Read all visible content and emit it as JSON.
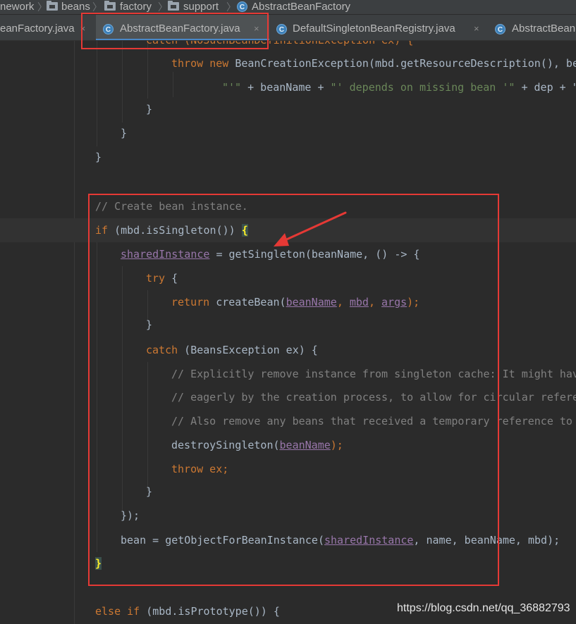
{
  "breadcrumb": {
    "items": [
      "nework",
      "beans",
      "factory",
      "support",
      "AbstractBeanFactory"
    ]
  },
  "tabs": [
    {
      "label": "eanFactory.java",
      "close": "×"
    },
    {
      "label": "AbstractBeanFactory.java",
      "close": "×"
    },
    {
      "label": "DefaultSingletonBeanRegistry.java",
      "close": "×"
    },
    {
      "label": "AbstractBean",
      "close": ""
    }
  ],
  "code": {
    "l0": "catch (NoSuchBeanDefinitionException ex) {",
    "l1_kw1": "throw",
    "l1_kw2": "new",
    "l1_rest": "BeanCreationException(mbd.getResourceDescription(), be",
    "l2_s1": "\"'\"",
    "l2_mid": " + beanName + ",
    "l2_s2": "\"' depends on missing bean '\"",
    "l2_tail": " + dep + \"",
    "l3": "}",
    "l4": "}",
    "l5": "}",
    "l6": "// Create bean instance.",
    "l7_kw": "if",
    "l7_rest": " (mbd.isSingleton()) ",
    "l7_brace": "{",
    "l8_fld": "sharedInstance",
    "l8_rest": " = getSingleton(beanName, () -> {",
    "l9_kw": "try",
    "l9_rest": " {",
    "l10_kw": "return",
    "l10_call": " createBean(",
    "l10_a1": "beanName",
    "l10_a2": "mbd",
    "l10_a3": "args",
    "l10_end": ");",
    "l11": "}",
    "l12_kw": "catch",
    "l12_rest": " (BeansException ex) {",
    "l13": "// Explicitly remove instance from singleton cache: It might hav",
    "l14": "// eagerly by the creation process, to allow for circular refere",
    "l15": "// Also remove any beans that received a temporary reference to",
    "l16_call": "destroySingleton(",
    "l16_arg": "beanName",
    "l16_end": ");",
    "l17_kw": "throw",
    "l17_rest": " ex;",
    "l18": "}",
    "l19": "});",
    "l20_a": "bean = getObjectForBeanInstance(",
    "l20_fld": "sharedInstance",
    "l20_b": ", name, beanName, mbd);",
    "l21": "}",
    "l22_kw1": "else",
    "l22_kw2": "if",
    "l22_rest": " (mbd.isPrototype()) {"
  },
  "watermark": "https://blog.csdn.net/qq_36882793",
  "colors": {
    "keyword": "#cc7832",
    "string": "#6a8759",
    "comment": "#808080",
    "field": "#9876aa",
    "annotation_red": "#e53935",
    "tab_underline": "#4a88c7"
  }
}
